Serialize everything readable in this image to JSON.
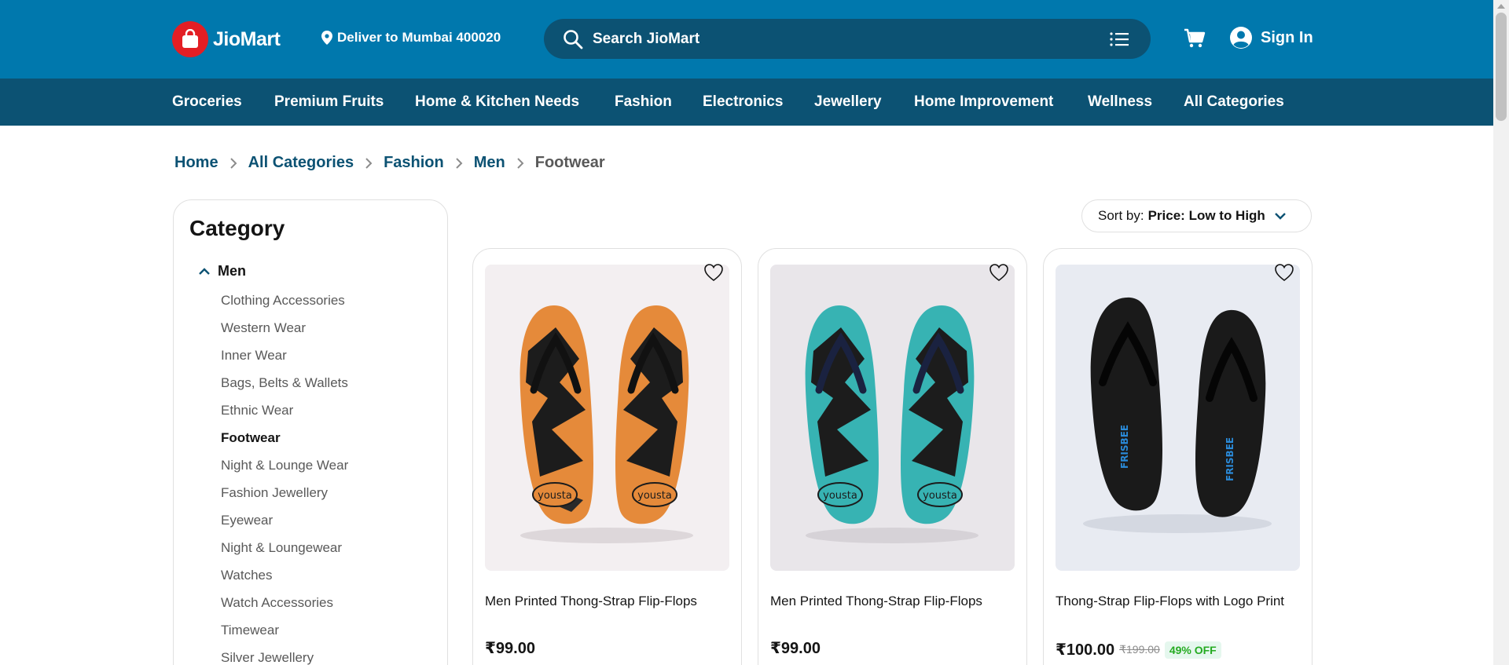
{
  "header": {
    "logo_text": "JioMart",
    "deliver_label": "Deliver to",
    "deliver_location": "Mumbai 400020",
    "search_placeholder": "Search JioMart",
    "sign_in": "Sign In",
    "colors": {
      "header_bg": "#0078ad",
      "nav_bg": "#0c5273",
      "logo_red": "#e31e24"
    }
  },
  "nav": {
    "items": [
      "Groceries",
      "Premium Fruits",
      "Home & Kitchen Needs",
      "Fashion",
      "Electronics",
      "Jewellery",
      "Home Improvement",
      "Wellness",
      "All Categories"
    ]
  },
  "breadcrumb": [
    "Home",
    "All Categories",
    "Fashion",
    "Men",
    "Footwear"
  ],
  "sidebar": {
    "title": "Category",
    "parent": "Men",
    "items": [
      "Clothing Accessories",
      "Western Wear",
      "Inner Wear",
      "Bags, Belts & Wallets",
      "Ethnic Wear",
      "Footwear",
      "Night & Lounge Wear",
      "Fashion Jewellery",
      "Eyewear",
      "Night & Loungewear",
      "Watches",
      "Watch Accessories",
      "Timewear",
      "Silver Jewellery"
    ],
    "active": "Footwear"
  },
  "sort": {
    "label": "Sort by:",
    "value": "Price: Low to High"
  },
  "products": [
    {
      "name": "Men Printed Thong-Strap Flip-Flops",
      "price": "₹99.00",
      "mrp": "",
      "off": "",
      "brand": "yousta",
      "sole_color": "#e58a3a",
      "bg": "#f3eff1"
    },
    {
      "name": "Men Printed Thong-Strap Flip-Flops",
      "price": "₹99.00",
      "mrp": "",
      "off": "",
      "brand": "yousta",
      "sole_color": "#37b3b3",
      "bg": "#e9e6ea"
    },
    {
      "name": "Thong-Strap Flip-Flops with Logo Print",
      "price": "₹100.00",
      "mrp": "₹199.00",
      "off": "49% OFF",
      "brand": "FRISBEE",
      "sole_color": "#1a1a1a",
      "bg": "#e8ebf2"
    }
  ]
}
